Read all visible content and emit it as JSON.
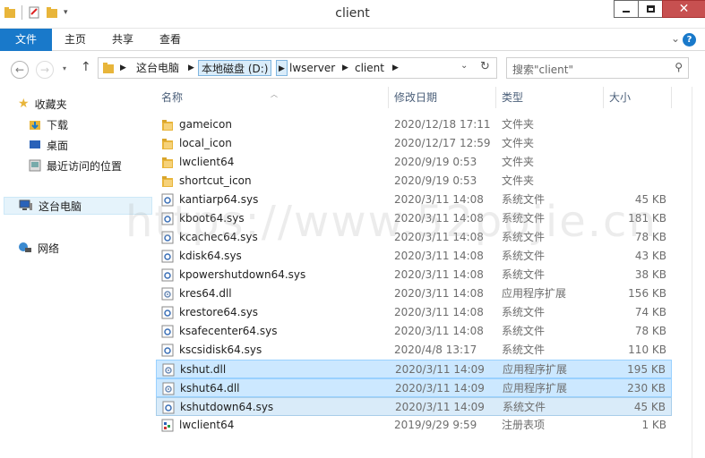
{
  "window": {
    "title": "client"
  },
  "ribbon": {
    "tabs": [
      "文件",
      "主页",
      "共享",
      "查看"
    ]
  },
  "address": {
    "crumbs": [
      "这台电脑",
      "本地磁盘 (D:)",
      "lwserver",
      "client"
    ],
    "search_placeholder": "搜索\"client\""
  },
  "sidebar": {
    "favorites": "收藏夹",
    "downloads": "下载",
    "desktop": "桌面",
    "recent": "最近访问的位置",
    "thispc": "这台电脑",
    "network": "网络"
  },
  "columns": {
    "name": "名称",
    "date": "修改日期",
    "type": "类型",
    "size": "大小"
  },
  "files": [
    {
      "name": "gameicon",
      "date": "2020/12/18 17:11",
      "type": "文件夹",
      "size": "",
      "icon": "folder"
    },
    {
      "name": "local_icon",
      "date": "2020/12/17 12:59",
      "type": "文件夹",
      "size": "",
      "icon": "folder"
    },
    {
      "name": "lwclient64",
      "date": "2020/9/19 0:53",
      "type": "文件夹",
      "size": "",
      "icon": "folder"
    },
    {
      "name": "shortcut_icon",
      "date": "2020/9/19 0:53",
      "type": "文件夹",
      "size": "",
      "icon": "folder"
    },
    {
      "name": "kantiarp64.sys",
      "date": "2020/3/11 14:08",
      "type": "系统文件",
      "size": "45 KB",
      "icon": "sys"
    },
    {
      "name": "kboot64.sys",
      "date": "2020/3/11 14:08",
      "type": "系统文件",
      "size": "181 KB",
      "icon": "sys"
    },
    {
      "name": "kcachec64.sys",
      "date": "2020/3/11 14:08",
      "type": "系统文件",
      "size": "78 KB",
      "icon": "sys"
    },
    {
      "name": "kdisk64.sys",
      "date": "2020/3/11 14:08",
      "type": "系统文件",
      "size": "43 KB",
      "icon": "sys"
    },
    {
      "name": "kpowershutdown64.sys",
      "date": "2020/3/11 14:08",
      "type": "系统文件",
      "size": "38 KB",
      "icon": "sys"
    },
    {
      "name": "kres64.dll",
      "date": "2020/3/11 14:08",
      "type": "应用程序扩展",
      "size": "156 KB",
      "icon": "dll"
    },
    {
      "name": "krestore64.sys",
      "date": "2020/3/11 14:08",
      "type": "系统文件",
      "size": "74 KB",
      "icon": "sys"
    },
    {
      "name": "ksafecenter64.sys",
      "date": "2020/3/11 14:08",
      "type": "系统文件",
      "size": "78 KB",
      "icon": "sys"
    },
    {
      "name": "kscsidisk64.sys",
      "date": "2020/4/8 13:17",
      "type": "系统文件",
      "size": "110 KB",
      "icon": "sys"
    },
    {
      "name": "kshut.dll",
      "date": "2020/3/11 14:09",
      "type": "应用程序扩展",
      "size": "195 KB",
      "icon": "dll"
    },
    {
      "name": "kshut64.dll",
      "date": "2020/3/11 14:09",
      "type": "应用程序扩展",
      "size": "230 KB",
      "icon": "dll"
    },
    {
      "name": "kshutdown64.sys",
      "date": "2020/3/11 14:09",
      "type": "系统文件",
      "size": "45 KB",
      "icon": "sys"
    },
    {
      "name": "lwclient64",
      "date": "2019/9/29 9:59",
      "type": "注册表项",
      "size": "1 KB",
      "icon": "reg"
    }
  ],
  "watermark": "https://www.52pojie.cn"
}
